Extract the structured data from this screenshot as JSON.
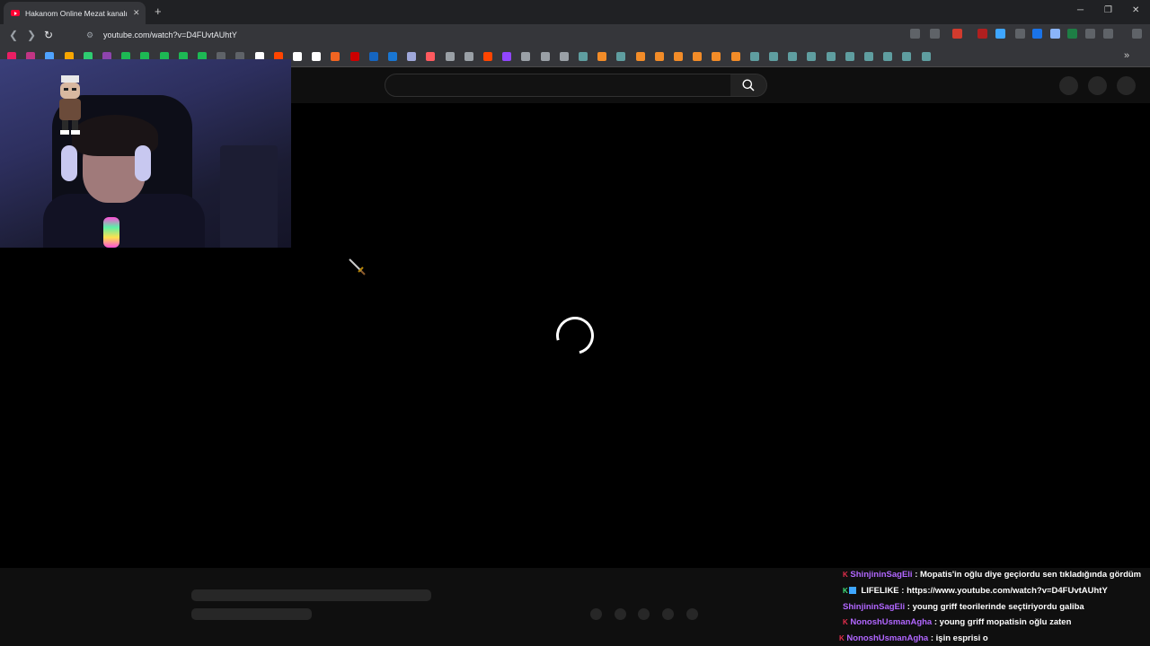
{
  "browser": {
    "tab_title": "Hakanom Online Mezat kanalı c",
    "tab_close": "✕",
    "new_tab": "+",
    "window_controls": [
      "─",
      "❐",
      "✕"
    ],
    "url": "youtube.com/watch?v=D4FUvtAUhtY",
    "back": "❮",
    "forward": "❯",
    "reload": "↻",
    "bookmarks_more": "»"
  },
  "toolbar_icons": [
    {
      "name": "cast-icon",
      "color": "#5f6368"
    },
    {
      "name": "share-icon",
      "color": "#5f6368"
    },
    {
      "name": "shield-extension-icon",
      "color": "#d13b2e"
    },
    {
      "name": "ublock-icon",
      "color": "#b01f1f"
    },
    {
      "name": "audio-extension-icon",
      "color": "#3ea6ff"
    },
    {
      "name": "pin-extension-icon",
      "color": "#5f6368"
    },
    {
      "name": "translate-extension-icon",
      "color": "#1a73e8"
    },
    {
      "name": "window-extension-icon",
      "color": "#8ab4f8"
    },
    {
      "name": "excel-extension-icon",
      "color": "#1e7e45"
    },
    {
      "name": "extensions-puzzle-icon",
      "color": "#5f6368"
    },
    {
      "name": "sidepanel-icon",
      "color": "#5f6368"
    },
    {
      "name": "menu-icon",
      "color": "#5f6368"
    }
  ],
  "bookmark_colors": [
    "#e91e63",
    "#c13584",
    "#4fa3ff",
    "#f7a600",
    "#2ecc71",
    "#8e44ad",
    "#1db954",
    "#1db954",
    "#1db954",
    "#1db954",
    "#1db954",
    "#5f6368",
    "#5f6368",
    "#ffffff",
    "#ff4500",
    "#ffffff",
    "#ffffff",
    "#f26522",
    "#cc0000",
    "#1565c0",
    "#1976d2",
    "#9fa8da",
    "#ff5a5f",
    "#9aa0a6",
    "#9aa0a6",
    "#ff4500",
    "#9146ff",
    "#9aa0a6",
    "#9aa0a6",
    "#9aa0a6",
    "#5f9ea0",
    "#f28c28",
    "#5f9ea0",
    "#f28c28",
    "#f28c28",
    "#f28c28",
    "#f28c28",
    "#f28c28",
    "#f28c28",
    "#5f9ea0",
    "#5f9ea0",
    "#5f9ea0",
    "#5f9ea0",
    "#5f9ea0",
    "#5f9ea0",
    "#5f9ea0",
    "#5f9ea0",
    "#5f9ea0",
    "#5f9ea0"
  ],
  "youtube": {
    "search_placeholder": ""
  },
  "chat": [
    {
      "badge": "K",
      "badge_green": false,
      "square": false,
      "user": "ShinjininSagEli",
      "text": ": Mopatis'in oğlu diye geçiordu sen tıkladığında gördüm"
    },
    {
      "badge": "K",
      "badge_green": true,
      "square": true,
      "user": "LIFELIKE",
      "text": ": https://www.youtube.com/watch?v=D4FUvtAUhtY"
    },
    {
      "badge": "",
      "badge_green": false,
      "square": false,
      "user": "ShinjininSagEli",
      "text": ": young griff teorilerinde seçtiriyordu galiba"
    },
    {
      "badge": "K",
      "badge_green": false,
      "square": false,
      "user": "NonoshUsmanAgha",
      "text": ": young griff mopatisin oğlu zaten"
    },
    {
      "badge": "K",
      "badge_green": false,
      "square": false,
      "user": "NonoshUsmanAgha",
      "text": ": işin esprisi o"
    }
  ]
}
